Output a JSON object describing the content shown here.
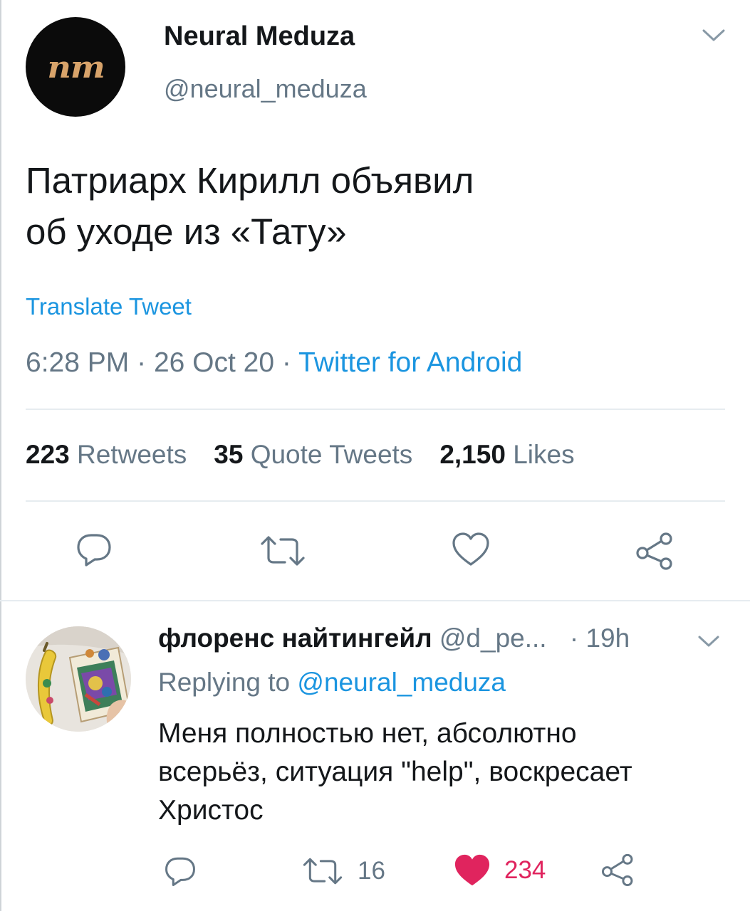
{
  "tweet": {
    "author_name": "Neural Meduza",
    "author_handle": "@neural_meduza",
    "avatar_text": "nm",
    "text_line1": "Патриарх Кирилл объявил",
    "text_line2": "об уходе из «Тату»",
    "translate_label": "Translate Tweet",
    "time": "6:28 PM",
    "date": "26 Oct 20",
    "separator": "·",
    "source": "Twitter for Android",
    "retweets_count": "223",
    "retweets_label": "Retweets",
    "quotes_count": "35",
    "quotes_label": "Quote Tweets",
    "likes_count": "2,150",
    "likes_label": "Likes"
  },
  "reply": {
    "author_name": "флоренс найтингейл",
    "author_handle": "@d_pe...",
    "age": "· 19h",
    "replying_prefix": "Replying to",
    "replying_mention": "@neural_meduza",
    "text_line1": "Меня полностью нет, абсолютно",
    "text_line2": "всерьёз, ситуация \"help\", воскресает",
    "text_line3": "Христос",
    "retweets_count": "16",
    "likes_count": "234"
  },
  "icons": {
    "reply": "comment-bubble-icon",
    "retweet": "retweet-icon",
    "like": "heart-icon",
    "share": "share-icon",
    "more": "chevron-down-icon"
  },
  "colors": {
    "link": "#1b95e0",
    "muted": "#657786",
    "like_active": "#e0245e",
    "text": "#14171a"
  }
}
